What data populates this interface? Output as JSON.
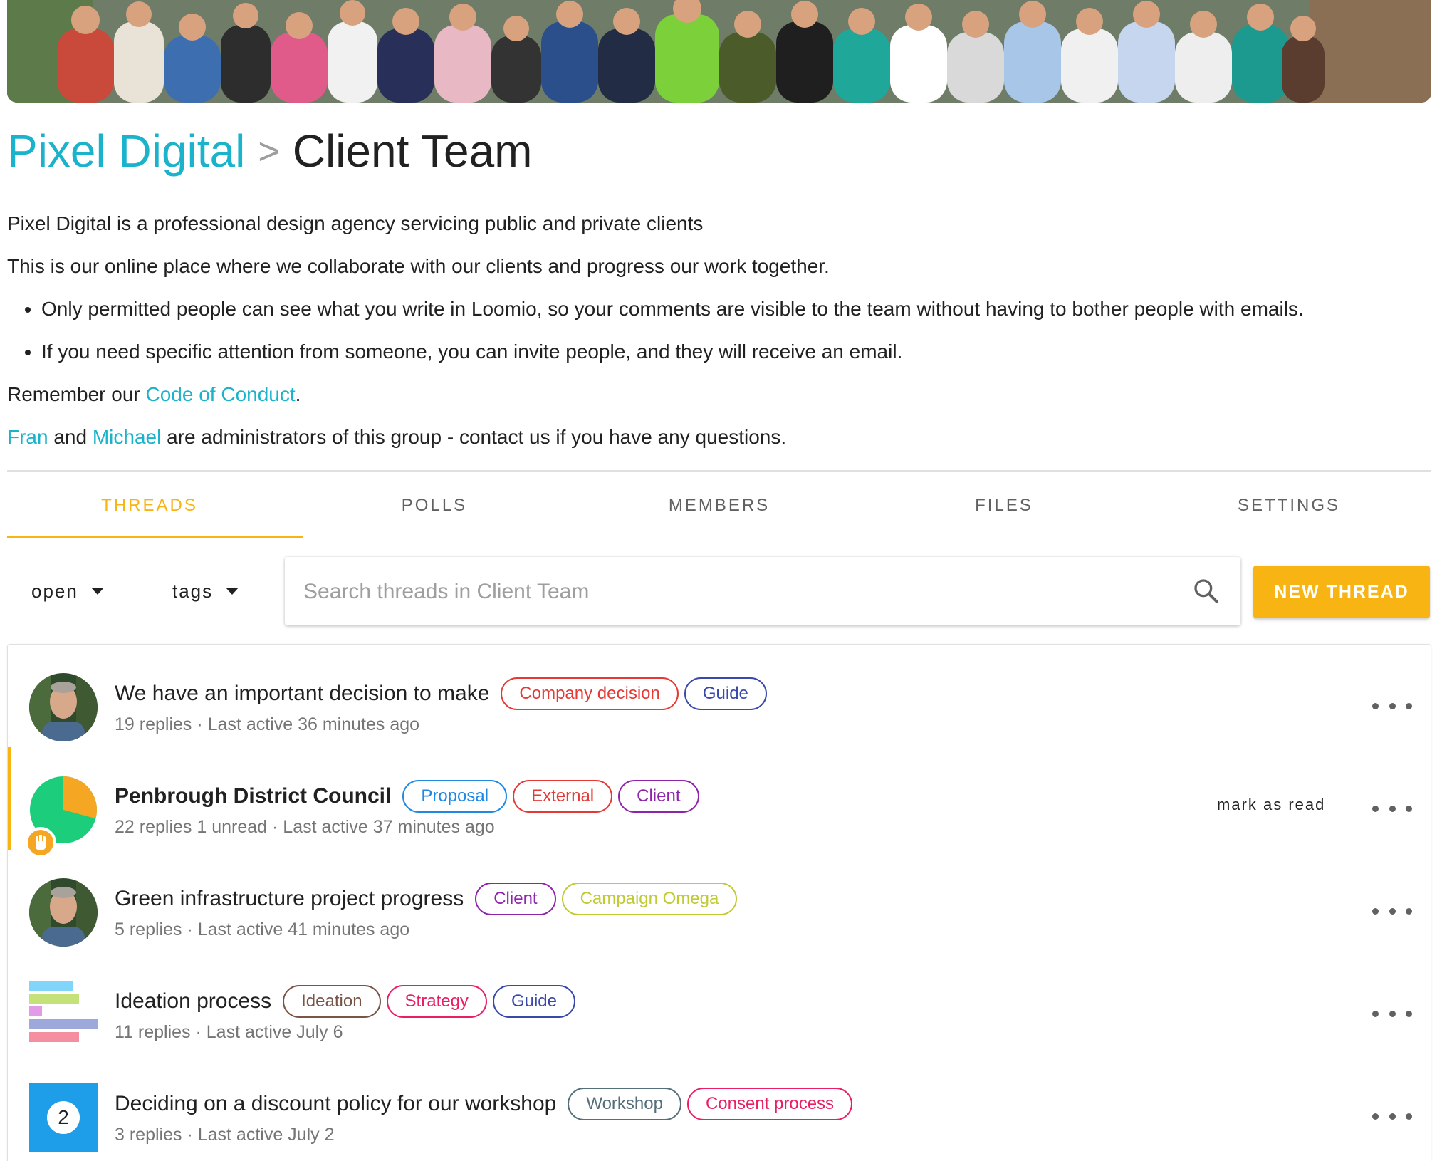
{
  "group": {
    "parent_name": "Pixel Digital",
    "separator": ">",
    "name": "Client Team"
  },
  "description": {
    "line1": "Pixel Digital is a professional design agency servicing public and private clients",
    "line2": "This is our online place where we collaborate with our clients and progress our work together.",
    "bullets": [
      "Only permitted people can see what you write in Loomio, so your comments are visible to the team without having to bother people with emails.",
      "If you need specific attention from someone, you can invite people, and they will receive an email."
    ],
    "conduct_prefix": "Remember our ",
    "conduct_link": "Code of Conduct",
    "conduct_suffix": ".",
    "admin_1": "Fran",
    "admin_and": " and ",
    "admin_2": "Michael",
    "admin_suffix": " are administrators of this group - contact us if you have any questions."
  },
  "tabs": [
    {
      "label": "THREADS",
      "active": true
    },
    {
      "label": "POLLS",
      "active": false
    },
    {
      "label": "MEMBERS",
      "active": false
    },
    {
      "label": "FILES",
      "active": false
    },
    {
      "label": "SETTINGS",
      "active": false
    }
  ],
  "filters": {
    "status": "open",
    "tags": "tags"
  },
  "search": {
    "placeholder": "Search threads in Client Team"
  },
  "new_thread_label": "NEW THREAD",
  "threads": [
    {
      "title": "We have an important decision to make",
      "tags": [
        {
          "label": "Company decision",
          "color": "#e53935"
        },
        {
          "label": "Guide",
          "color": "#3949ab"
        }
      ],
      "replies": "19 replies",
      "unread": "",
      "last_active": "· Last active 36 minutes ago",
      "avatar": "person-photo"
    },
    {
      "title": "Penbrough District Council",
      "tags": [
        {
          "label": "Proposal",
          "color": "#1e88e5"
        },
        {
          "label": "External",
          "color": "#e53935"
        },
        {
          "label": "Client",
          "color": "#8e24aa"
        }
      ],
      "replies": "22 replies",
      "unread": "1 unread",
      "last_active": "· Last active 37 minutes ago",
      "mark_as_read": "mark as read",
      "avatar": "proposal-pie-chart",
      "colors": {
        "pie_green": "#1ccd7c",
        "pie_orange": "#f5a623"
      }
    },
    {
      "title": "Green infrastructure project progress",
      "tags": [
        {
          "label": "Client",
          "color": "#8e24aa"
        },
        {
          "label": "Campaign Omega",
          "color": "#c0ca33"
        }
      ],
      "replies": "5 replies",
      "unread": "",
      "last_active": "· Last active 41 minutes ago",
      "avatar": "person-photo"
    },
    {
      "title": "Ideation process",
      "tags": [
        {
          "label": "Ideation",
          "color": "#795548"
        },
        {
          "label": "Strategy",
          "color": "#e91e63"
        },
        {
          "label": "Guide",
          "color": "#3949ab"
        }
      ],
      "replies": "11 replies",
      "unread": "",
      "last_active": "· Last active July 6",
      "avatar": "poll-bar-chart"
    },
    {
      "title": "Deciding on a discount policy for our workshop",
      "tags": [
        {
          "label": "Workshop",
          "color": "#546e7a"
        },
        {
          "label": "Consent process",
          "color": "#e91e63"
        }
      ],
      "replies": "3 replies",
      "unread": "",
      "last_active": "· Last active July 2",
      "avatar": "score-poll",
      "score": "2"
    }
  ],
  "colors": {
    "accent": "#f7b413",
    "link": "#1bb3cc",
    "score_bg": "#1e9ee8"
  }
}
